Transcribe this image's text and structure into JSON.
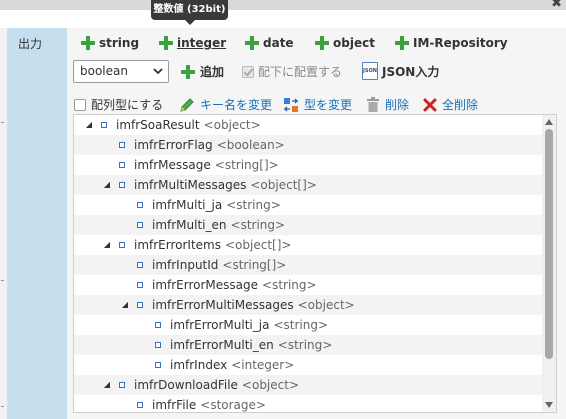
{
  "tooltip": "整数値 (32bit)",
  "close_label": "✖",
  "sidebar": {
    "label": "出力"
  },
  "tabs": [
    {
      "label": "string"
    },
    {
      "label": "integer"
    },
    {
      "label": "date"
    },
    {
      "label": "object"
    },
    {
      "label": "IM-Repository"
    }
  ],
  "toolbar": {
    "type_select": "boolean",
    "add_label": "追加",
    "place_below_label": "配下に配置する",
    "json_icon_text": "JSON",
    "json_input_label": "JSON入力"
  },
  "actions": {
    "array_type_label": "配列型にする",
    "rename_key_label": "キー名を変更",
    "change_type_label": "型を変更",
    "delete_label": "削除",
    "delete_all_label": "全削除"
  },
  "tree": [
    {
      "name": "imfrSoaResult",
      "type": "<object>",
      "expanded": true
    },
    {
      "name": "imfrErrorFlag",
      "type": "<boolean>"
    },
    {
      "name": "imfrMessage",
      "type": "<string[]>"
    },
    {
      "name": "imfrMultiMessages",
      "type": "<object[]>",
      "expanded": true
    },
    {
      "name": "imfrMulti_ja",
      "type": "<string>"
    },
    {
      "name": "imfrMulti_en",
      "type": "<string>"
    },
    {
      "name": "imfrErrorItems",
      "type": "<object[]>",
      "expanded": true
    },
    {
      "name": "imfrInputId",
      "type": "<string[]>"
    },
    {
      "name": "imfrErrorMessage",
      "type": "<string>"
    },
    {
      "name": "imfrErrorMultiMessages",
      "type": "<object>",
      "expanded": true
    },
    {
      "name": "imfrErrorMulti_ja",
      "type": "<string>"
    },
    {
      "name": "imfrErrorMulti_en",
      "type": "<string>"
    },
    {
      "name": "imfrIndex",
      "type": "<integer>"
    },
    {
      "name": "imfrDownloadFile",
      "type": "<object>",
      "expanded": true
    },
    {
      "name": "imfrFile",
      "type": "<storage>"
    }
  ],
  "colors": {
    "accent_blue": "#1a6fb8",
    "sidebar_bg": "#c5dfee",
    "plus_green": "#3aa13e",
    "delete_red": "#cc2222"
  },
  "icons": {
    "expand": "triangle-expanded-icon",
    "node": "square-node-icon"
  }
}
